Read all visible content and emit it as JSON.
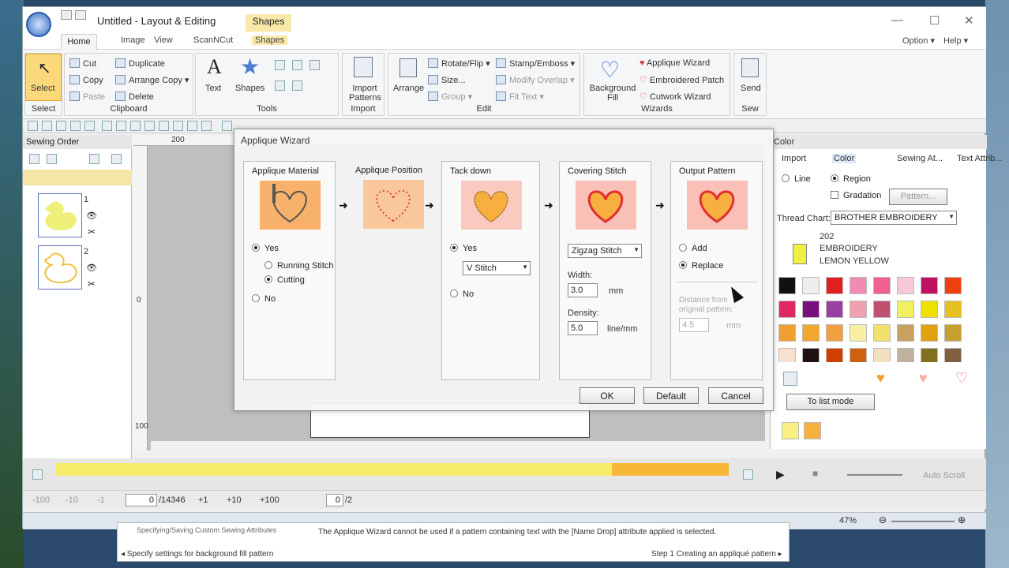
{
  "window": {
    "title": "Untitled - Layout & Editing",
    "context_tab": "Shapes",
    "controls": [
      "—",
      "☐",
      "✕"
    ]
  },
  "tabs": [
    "Home",
    "Image",
    "View",
    "ScanNCut",
    "Shapes"
  ],
  "tabs_right": [
    "Option ▾",
    "Help ▾"
  ],
  "ribbon": {
    "select": {
      "label": "Select",
      "group": "Select"
    },
    "clipboard": {
      "group": "Clipboard",
      "cut": "Cut",
      "copy": "Copy",
      "paste": "Paste",
      "duplicate": "Duplicate",
      "arrange_copy": "Arrange Copy",
      "delete": "Delete"
    },
    "tools": {
      "group": "Tools",
      "text": "Text",
      "shapes": "Shapes"
    },
    "import": {
      "group": "Import",
      "label": "Import Patterns"
    },
    "edit": {
      "group": "Edit",
      "arrange": "Arrange",
      "rotate": "Rotate/Flip",
      "size": "Size...",
      "group_btn": "Group",
      "stamp": "Stamp/Emboss",
      "modify": "Modify Overlap",
      "fit": "Fit Text"
    },
    "wizards": {
      "group": "Wizards",
      "background": "Background Fill",
      "applique": "Applique Wizard",
      "embroidered": "Embroidered Patch",
      "cutwork": "Cutwork Wizard"
    },
    "sew": {
      "group": "Sew",
      "send": "Send"
    }
  },
  "sewing_order": {
    "title": "Sewing Order",
    "items": [
      {
        "num": "1"
      },
      {
        "num": "2"
      }
    ]
  },
  "ruler": {
    "h": "200",
    "v1": "0",
    "v2": "100"
  },
  "dialog": {
    "title": "Applique Wizard",
    "steps": [
      {
        "title": "Applique Material"
      },
      {
        "title": "Applique Position"
      },
      {
        "title": "Tack down"
      },
      {
        "title": "Covering Stitch"
      },
      {
        "title": "Output Pattern"
      }
    ],
    "material": {
      "yes": "Yes",
      "running": "Running Stitch",
      "cutting": "Cutting",
      "no": "No"
    },
    "tack": {
      "yes": "Yes",
      "stitch": "V Stitch",
      "no": "No"
    },
    "covering": {
      "stitch": "Zigzag Stitch",
      "width_label": "Width:",
      "width": "3.0",
      "width_unit": "mm",
      "density_label": "Density:",
      "density": "5.0",
      "density_unit": "line/mm"
    },
    "output": {
      "add": "Add",
      "replace": "Replace",
      "distance_label": "Distance from original pattern:",
      "distance": "4.5",
      "distance_unit": "mm"
    },
    "buttons": {
      "ok": "OK",
      "default": "Default",
      "cancel": "Cancel"
    }
  },
  "color_panel": {
    "title": "Color",
    "tabs": [
      "Import",
      "Color",
      "Sewing At...",
      "Text Attrib..."
    ],
    "line": "Line",
    "region": "Region",
    "gradation": "Gradation",
    "pattern_btn": "Pattern...",
    "thread_chart_label": "Thread Chart:",
    "thread_chart": "BROTHER EMBROIDERY",
    "thread_num": "202",
    "thread_brand": "EMBROIDERY",
    "thread_name": "LEMON YELLOW",
    "swatches": [
      "#111111",
      "#eeeeee",
      "#e02020",
      "#f08cb4",
      "#f06090",
      "#f8c8d8",
      "#c01060",
      "#f04010",
      "#e02860",
      "#7a1080",
      "#9a40a0",
      "#f0a0b0",
      "#c05070",
      "#f0f060",
      "#f0e000",
      "#e8c020",
      "#f0a030",
      "#f0a830",
      "#f0a040",
      "#f8f0a0",
      "#f0e070",
      "#c8a060",
      "#e0a010",
      "#c8a030",
      "#f8e0d0",
      "#201010",
      "#d04000",
      "#d06010",
      "#f0e0c0",
      "#c0b0a0",
      "#807020",
      "#806040"
    ],
    "list_mode": "To list mode"
  },
  "timeline": {
    "counter": "0",
    "total": "/14346",
    "page": "0",
    "page_total": "/2",
    "steps": [
      "-100",
      "-10",
      "-1",
      "+1",
      "+10",
      "+100"
    ],
    "auto_scroll": "Auto Scroll"
  },
  "status": {
    "zoom": "47%"
  },
  "help": {
    "left1": "Specifying/Saving Custom Sewing Attributes",
    "left2": "◂ Specify settings for background fill pattern",
    "notice": "The Applique Wizard cannot be used if a pattern containing text with the [Name Drop] attribute applied is selected.",
    "right": "Step 1 Creating an appliqué pattern ▸"
  }
}
